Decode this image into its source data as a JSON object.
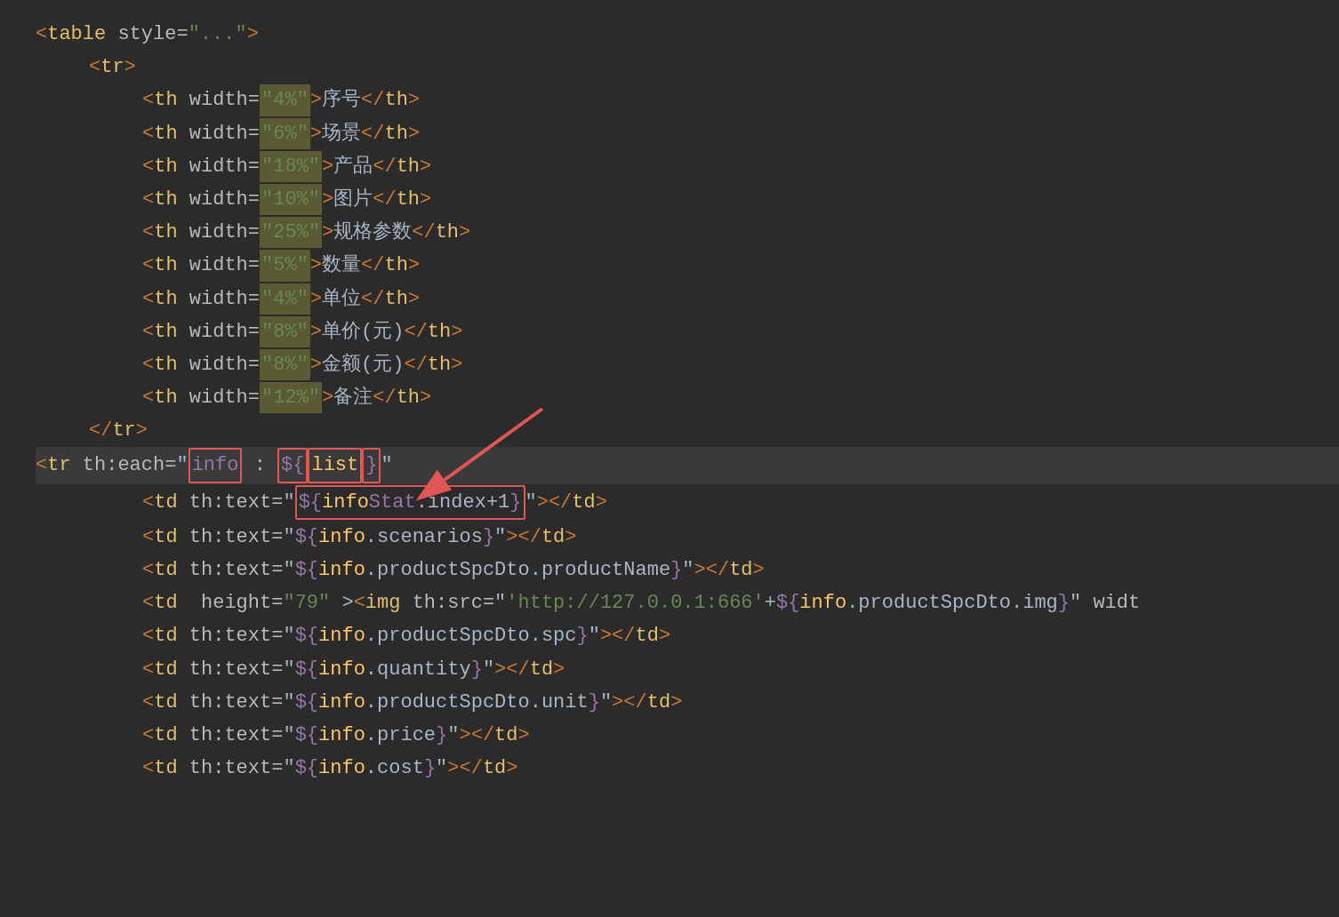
{
  "editor": {
    "background": "#2b2b2b",
    "lines": [
      {
        "id": "line-table",
        "indent": 0,
        "parts": [
          {
            "type": "tag-bracket",
            "text": "<"
          },
          {
            "type": "tag",
            "text": "table"
          },
          {
            "type": "attr-name",
            "text": " style="
          },
          {
            "type": "attr-value",
            "text": "\"...\""
          },
          {
            "type": "tag-bracket",
            "text": ">"
          }
        ]
      },
      {
        "id": "line-tr-open",
        "indent": 1,
        "parts": [
          {
            "type": "tag-bracket",
            "text": "<"
          },
          {
            "type": "tag",
            "text": "tr"
          },
          {
            "type": "tag-bracket",
            "text": ">"
          }
        ]
      },
      {
        "id": "line-th-1",
        "indent": 2,
        "highlight": true,
        "parts": [
          {
            "type": "tag-bracket",
            "text": "<"
          },
          {
            "type": "tag",
            "text": "th"
          },
          {
            "type": "attr-name",
            "text": " width="
          },
          {
            "type": "attr-value",
            "text": "\"4%\""
          },
          {
            "type": "tag-bracket",
            "text": ">"
          },
          {
            "type": "text-content",
            "text": "序号"
          },
          {
            "type": "tag-bracket",
            "text": "</"
          },
          {
            "type": "tag",
            "text": "th"
          },
          {
            "type": "tag-bracket",
            "text": ">"
          }
        ]
      },
      {
        "id": "line-th-2",
        "indent": 2,
        "highlight": true,
        "parts": [
          {
            "type": "tag-bracket",
            "text": "<"
          },
          {
            "type": "tag",
            "text": "th"
          },
          {
            "type": "attr-name",
            "text": " width="
          },
          {
            "type": "attr-value",
            "text": "\"6%\""
          },
          {
            "type": "tag-bracket",
            "text": ">"
          },
          {
            "type": "text-content",
            "text": "场景"
          },
          {
            "type": "tag-bracket",
            "text": "</"
          },
          {
            "type": "tag",
            "text": "th"
          },
          {
            "type": "tag-bracket",
            "text": ">"
          }
        ]
      },
      {
        "id": "line-th-3",
        "indent": 2,
        "highlight": true,
        "parts": [
          {
            "type": "tag-bracket",
            "text": "<"
          },
          {
            "type": "tag",
            "text": "th"
          },
          {
            "type": "attr-name",
            "text": " width="
          },
          {
            "type": "attr-value",
            "text": "\"18%\""
          },
          {
            "type": "tag-bracket",
            "text": ">"
          },
          {
            "type": "text-content",
            "text": "产品"
          },
          {
            "type": "tag-bracket",
            "text": "</"
          },
          {
            "type": "tag",
            "text": "th"
          },
          {
            "type": "tag-bracket",
            "text": ">"
          }
        ]
      },
      {
        "id": "line-th-4",
        "indent": 2,
        "highlight": true,
        "parts": [
          {
            "type": "tag-bracket",
            "text": "<"
          },
          {
            "type": "tag",
            "text": "th"
          },
          {
            "type": "attr-name",
            "text": " width="
          },
          {
            "type": "attr-value",
            "text": "\"10%\""
          },
          {
            "type": "tag-bracket",
            "text": ">"
          },
          {
            "type": "text-content",
            "text": "图片"
          },
          {
            "type": "tag-bracket",
            "text": "</"
          },
          {
            "type": "tag",
            "text": "th"
          },
          {
            "type": "tag-bracket",
            "text": ">"
          }
        ]
      },
      {
        "id": "line-th-5",
        "indent": 2,
        "highlight": true,
        "parts": [
          {
            "type": "tag-bracket",
            "text": "<"
          },
          {
            "type": "tag",
            "text": "th"
          },
          {
            "type": "attr-name",
            "text": " width="
          },
          {
            "type": "attr-value",
            "text": "\"25%\""
          },
          {
            "type": "tag-bracket",
            "text": ">"
          },
          {
            "type": "text-content",
            "text": "规格参数"
          },
          {
            "type": "tag-bracket",
            "text": "</"
          },
          {
            "type": "tag",
            "text": "th"
          },
          {
            "type": "tag-bracket",
            "text": ">"
          }
        ]
      },
      {
        "id": "line-th-6",
        "indent": 2,
        "highlight": true,
        "parts": [
          {
            "type": "tag-bracket",
            "text": "<"
          },
          {
            "type": "tag",
            "text": "th"
          },
          {
            "type": "attr-name",
            "text": " width="
          },
          {
            "type": "attr-value",
            "text": "\"5%\""
          },
          {
            "type": "tag-bracket",
            "text": ">"
          },
          {
            "type": "text-content",
            "text": "数量"
          },
          {
            "type": "tag-bracket",
            "text": "</"
          },
          {
            "type": "tag",
            "text": "th"
          },
          {
            "type": "tag-bracket",
            "text": ">"
          }
        ]
      },
      {
        "id": "line-th-7",
        "indent": 2,
        "highlight": true,
        "parts": [
          {
            "type": "tag-bracket",
            "text": "<"
          },
          {
            "type": "tag",
            "text": "th"
          },
          {
            "type": "attr-name",
            "text": " width="
          },
          {
            "type": "attr-value",
            "text": "\"4%\""
          },
          {
            "type": "tag-bracket",
            "text": ">"
          },
          {
            "type": "text-content",
            "text": "单位"
          },
          {
            "type": "tag-bracket",
            "text": "</"
          },
          {
            "type": "tag",
            "text": "th"
          },
          {
            "type": "tag-bracket",
            "text": ">"
          }
        ]
      },
      {
        "id": "line-th-8",
        "indent": 2,
        "highlight": true,
        "parts": [
          {
            "type": "tag-bracket",
            "text": "<"
          },
          {
            "type": "tag",
            "text": "th"
          },
          {
            "type": "attr-name",
            "text": " width="
          },
          {
            "type": "attr-value",
            "text": "\"8%\""
          },
          {
            "type": "tag-bracket",
            "text": ">"
          },
          {
            "type": "text-content",
            "text": "单价(元)"
          },
          {
            "type": "tag-bracket",
            "text": "</"
          },
          {
            "type": "tag",
            "text": "th"
          },
          {
            "type": "tag-bracket",
            "text": ">"
          }
        ]
      },
      {
        "id": "line-th-9",
        "indent": 2,
        "highlight": true,
        "parts": [
          {
            "type": "tag-bracket",
            "text": "<"
          },
          {
            "type": "tag",
            "text": "th"
          },
          {
            "type": "attr-name",
            "text": " width="
          },
          {
            "type": "attr-value",
            "text": "\"8%\""
          },
          {
            "type": "tag-bracket",
            "text": ">"
          },
          {
            "type": "text-content",
            "text": "金额(元)"
          },
          {
            "type": "tag-bracket",
            "text": "</"
          },
          {
            "type": "tag",
            "text": "th"
          },
          {
            "type": "tag-bracket",
            "text": ">"
          }
        ]
      },
      {
        "id": "line-th-10",
        "indent": 2,
        "highlight": true,
        "parts": [
          {
            "type": "tag-bracket",
            "text": "<"
          },
          {
            "type": "tag",
            "text": "th"
          },
          {
            "type": "attr-name",
            "text": " width="
          },
          {
            "type": "attr-value",
            "text": "\"12%\""
          },
          {
            "type": "tag-bracket",
            "text": ">"
          },
          {
            "type": "text-content",
            "text": "备注"
          },
          {
            "type": "tag-bracket",
            "text": "</"
          },
          {
            "type": "tag",
            "text": "th"
          },
          {
            "type": "tag-bracket",
            "text": ">"
          }
        ]
      },
      {
        "id": "line-tr-close",
        "indent": 1,
        "parts": [
          {
            "type": "tag-bracket",
            "text": "</"
          },
          {
            "type": "tag",
            "text": "tr"
          },
          {
            "type": "tag-bracket",
            "text": ">"
          }
        ]
      }
    ],
    "tr_each_line": {
      "prefix": "<tr",
      "attr_name": " th:each=",
      "quote_open": "\"",
      "info_boxed": "info",
      "colon_space": " : ",
      "list_boxed": "${list}",
      "quote_close": "\""
    },
    "td_lines": [
      {
        "id": "td-1",
        "indent": 2,
        "text": "<td th:text=\"${infoStat.index+1}\"></td>"
      },
      {
        "id": "td-2",
        "indent": 2,
        "text": "<td th:text=\"${info.scenarios}\"></td>"
      },
      {
        "id": "td-3",
        "indent": 2,
        "text": "<td th:text=\"${info.productSpcDto.productName}\"></td>"
      },
      {
        "id": "td-4",
        "indent": 2,
        "text": "<td  height=\"79\" ><img th:src=\"'http://127.0.0.1:666'+${info.productSpcDto.img}\" widt"
      },
      {
        "id": "td-5",
        "indent": 2,
        "text": "<td th:text=\"${info.productSpcDto.spc}\"></td>"
      },
      {
        "id": "td-6",
        "indent": 2,
        "text": "<td th:text=\"${info.quantity}\"></td>"
      },
      {
        "id": "td-7",
        "indent": 2,
        "text": "<td th:text=\"${info.productSpcDto.unit}\"></td>"
      },
      {
        "id": "td-8",
        "indent": 2,
        "text": "<td th:text=\"${info.price}\"></td>"
      },
      {
        "id": "td-9",
        "indent": 2,
        "text": "<td th:text=\"${info.cost}\"></td>"
      }
    ]
  }
}
